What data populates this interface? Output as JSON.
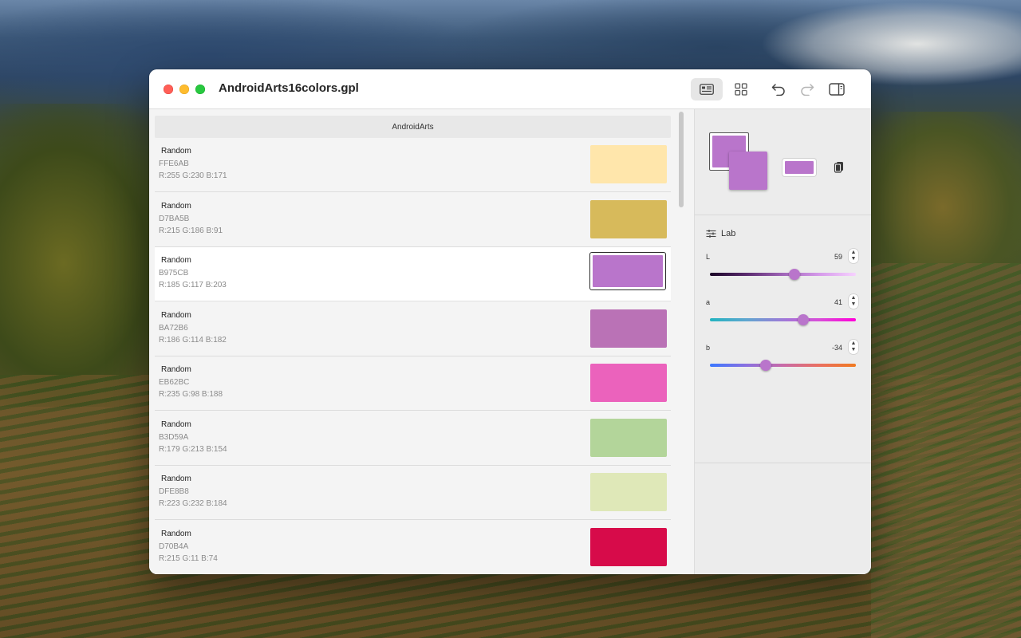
{
  "window": {
    "title": "AndroidArts16colors.gpl"
  },
  "toolbar": {
    "list_view_icon": "list-view-icon",
    "grid_view_icon": "grid-view-icon",
    "undo_icon": "undo-icon",
    "redo_icon": "redo-icon",
    "sidebar_icon": "sidebar-toggle-icon"
  },
  "palette": {
    "group_name": "AndroidArts",
    "colors": [
      {
        "name": "Random",
        "hex": "FFE6AB",
        "rgb": "R:255 G:230 B:171",
        "color": "#FFE6AB"
      },
      {
        "name": "Random",
        "hex": "D7BA5B",
        "rgb": "R:215 G:186 B:91",
        "color": "#D7BA5B"
      },
      {
        "name": "Random",
        "hex": "B975CB",
        "rgb": "R:185 G:117 B:203",
        "color": "#B975CB"
      },
      {
        "name": "Random",
        "hex": "BA72B6",
        "rgb": "R:186 G:114 B:182",
        "color": "#BA72B6"
      },
      {
        "name": "Random",
        "hex": "EB62BC",
        "rgb": "R:235 G:98 B:188",
        "color": "#EB62BC"
      },
      {
        "name": "Random",
        "hex": "B3D59A",
        "rgb": "R:179 G:213 B:154",
        "color": "#B3D59A"
      },
      {
        "name": "Random",
        "hex": "DFE8B8",
        "rgb": "R:223 G:232 B:184",
        "color": "#DFE8B8"
      },
      {
        "name": "Random",
        "hex": "D70B4A",
        "rgb": "R:215 G:11 B:74",
        "color": "#D70B4A"
      }
    ],
    "selected_index": 2
  },
  "inspector": {
    "current_color": "#B975CB",
    "mode_label": "Lab",
    "channels": [
      {
        "label": "L",
        "value": "59",
        "fraction": 0.58,
        "gradient": "linear-gradient(90deg,#1a0626,#5a2a6e,#a065b8,#d59aea,#f7d2ff)"
      },
      {
        "label": "a",
        "value": "41",
        "fraction": 0.64,
        "gradient": "linear-gradient(90deg,#22b4c0,#5fa6d0,#9e7ad8,#d94cd8,#ff00d8)"
      },
      {
        "label": "b",
        "value": "-34",
        "fraction": 0.38,
        "gradient": "linear-gradient(90deg,#3a78ff,#8a70e0,#c86aa8,#ea7060,#f07a20)"
      }
    ]
  }
}
